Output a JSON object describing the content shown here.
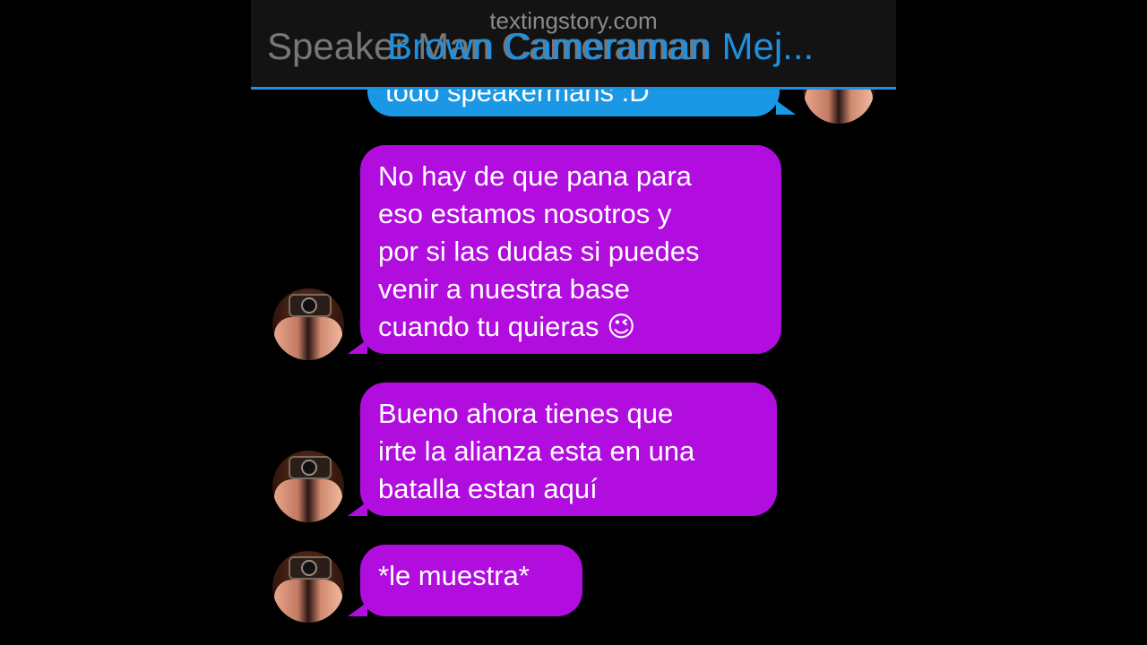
{
  "header": {
    "watermark": "textingstory.com",
    "title_back": "Speaker Man Cameraman",
    "title_front": "Brown Cameraman Mej..."
  },
  "colors": {
    "incoming_bubble": "#b10ddf",
    "outgoing_bubble": "#1a98e6",
    "accent": "#1e90e0",
    "background": "#000000"
  },
  "messages": [
    {
      "direction": "outgoing",
      "text": "todo speakermans :D",
      "avatar": "brown-cameraman-avatar"
    },
    {
      "direction": "incoming",
      "lines": [
        "No hay de que pana para",
        "eso estamos nosotros y",
        "por si las dudas si puedes",
        "venir a nuestra base",
        "cuando tu quieras 😉"
      ],
      "avatar": "speaker-cameraman-avatar"
    },
    {
      "direction": "incoming",
      "lines": [
        "Bueno ahora tienes que",
        "irte la alianza esta en una",
        "batalla estan aquí"
      ],
      "avatar": "speaker-cameraman-avatar"
    },
    {
      "direction": "incoming",
      "lines": [
        "*le muestra*"
      ],
      "avatar": "speaker-cameraman-avatar"
    }
  ]
}
